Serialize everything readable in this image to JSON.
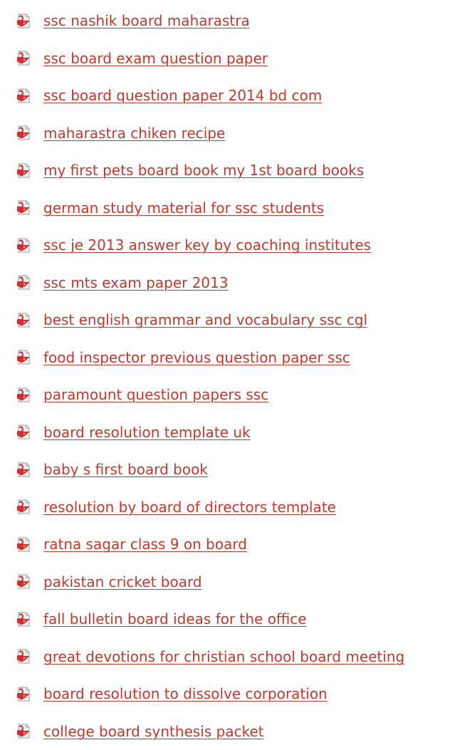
{
  "links": [
    {
      "label": "ssc nashik board maharastra"
    },
    {
      "label": "ssc board exam question paper"
    },
    {
      "label": "ssc board question paper 2014 bd com"
    },
    {
      "label": "maharastra chiken recipe"
    },
    {
      "label": "my first pets board book my 1st board books"
    },
    {
      "label": "german study material for ssc students"
    },
    {
      "label": "ssc je 2013 answer key by coaching institutes"
    },
    {
      "label": "ssc mts exam paper 2013"
    },
    {
      "label": "best english grammar and vocabulary ssc cgl"
    },
    {
      "label": "food inspector previous question paper ssc"
    },
    {
      "label": "paramount question papers ssc"
    },
    {
      "label": "board resolution template uk"
    },
    {
      "label": "baby s first board book"
    },
    {
      "label": "resolution by board of directors template"
    },
    {
      "label": "ratna sagar class 9 on board"
    },
    {
      "label": "pakistan cricket board"
    },
    {
      "label": "fall bulletin board ideas for the office"
    },
    {
      "label": "great devotions for christian school board meeting"
    },
    {
      "label": "board resolution to dissolve corporation"
    },
    {
      "label": "college board synthesis packet"
    }
  ],
  "icon": {
    "name": "pdf-file-icon",
    "color": "#d32f2f"
  },
  "link_color": "#c0392b"
}
